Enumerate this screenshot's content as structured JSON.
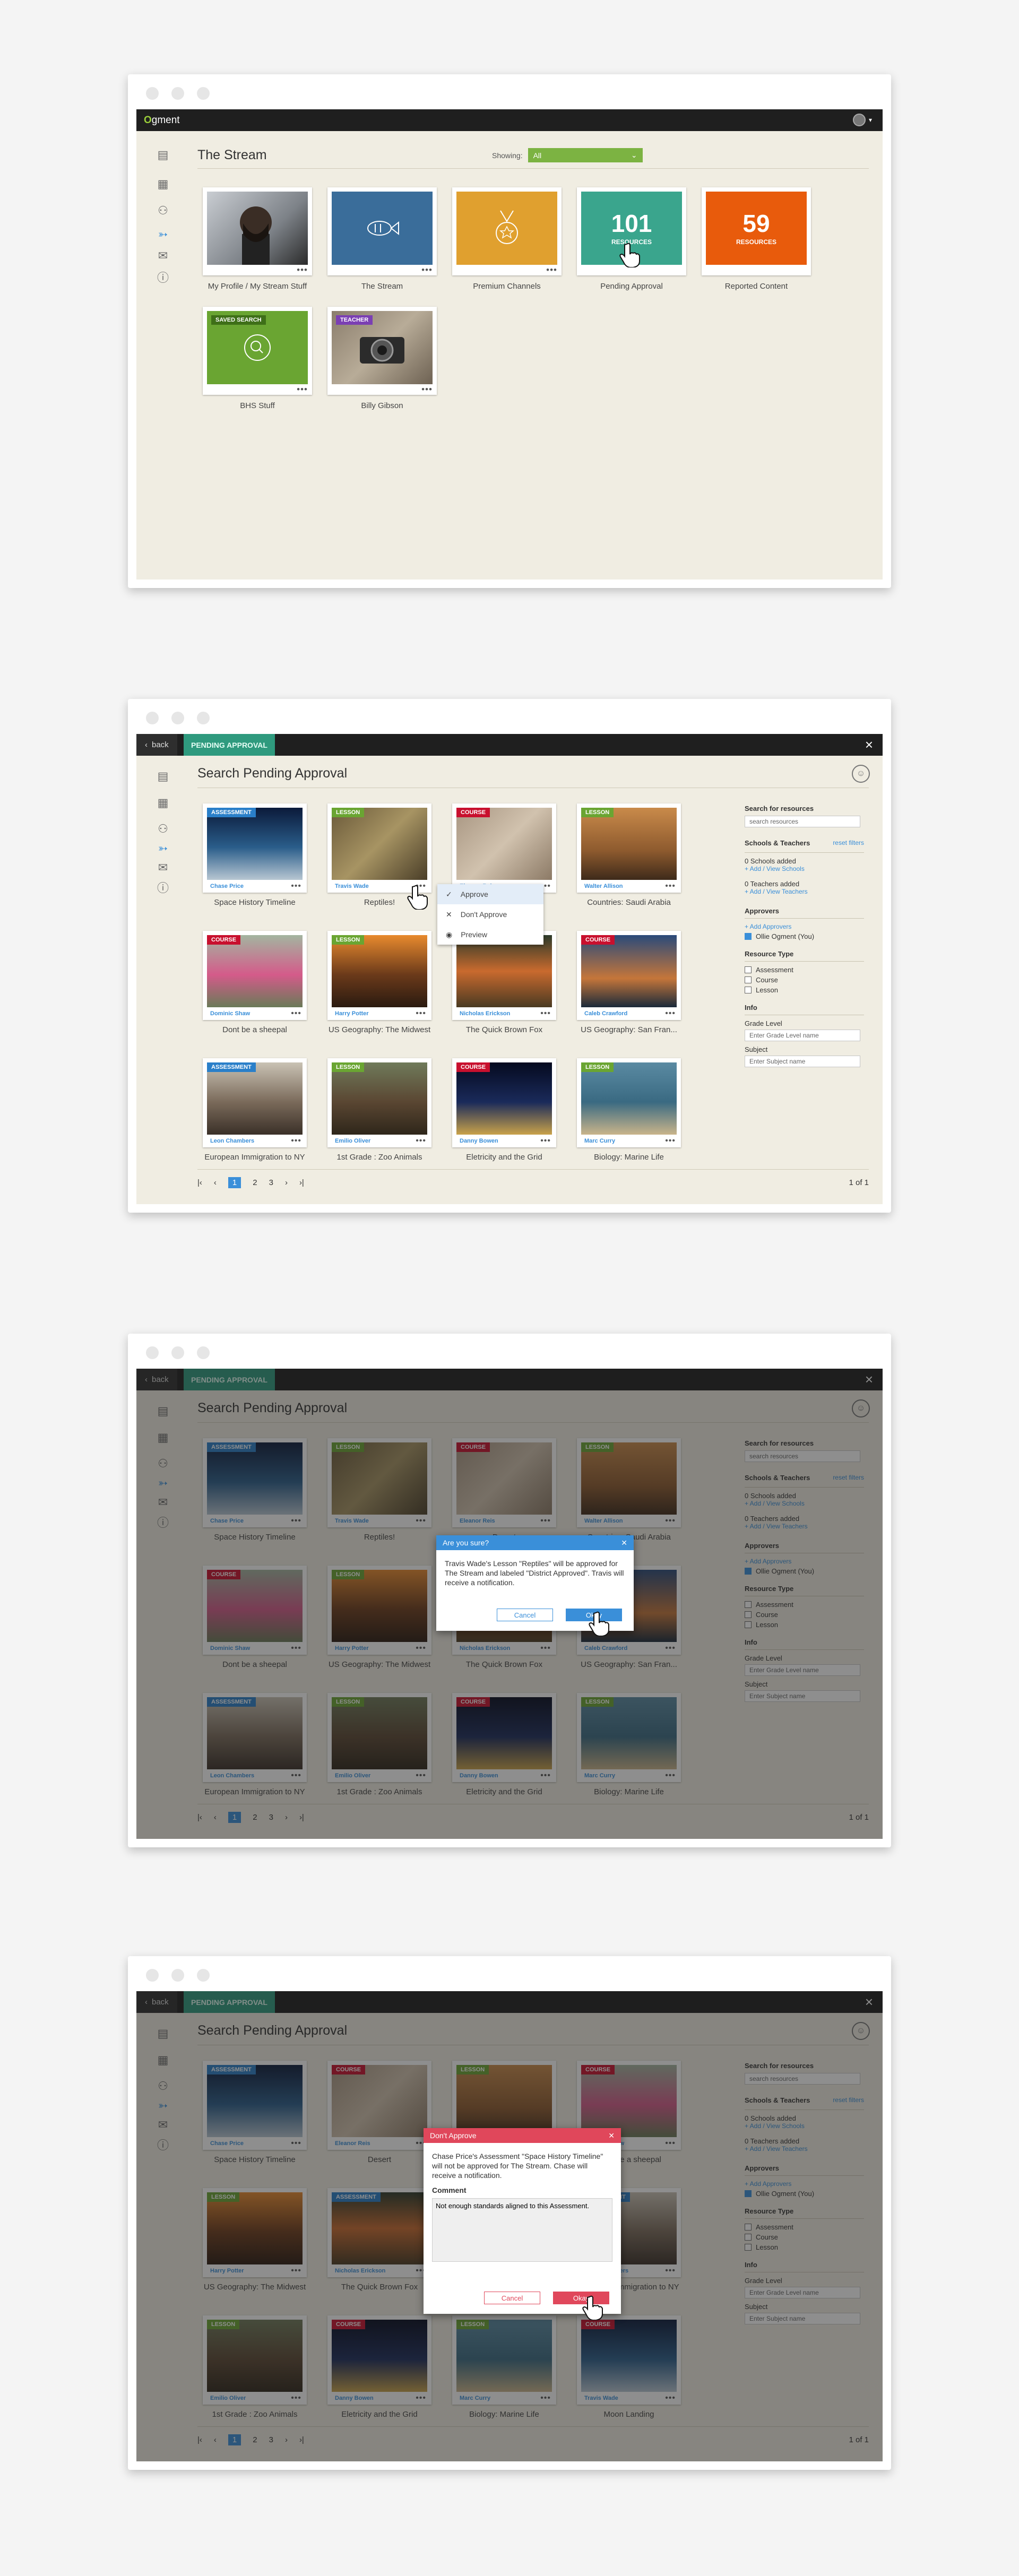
{
  "app": {
    "logo_prefix": "O",
    "logo_rest": "gment"
  },
  "panel1": {
    "title": "The Stream",
    "showing_label": "Showing:",
    "showing_value": "All",
    "tiles": [
      {
        "caption": "My Profile / My Stream Stuff"
      },
      {
        "caption": "The Stream"
      },
      {
        "caption": "Premium Channels"
      },
      {
        "caption": "Pending Approval",
        "count": "101",
        "unit": "RESOURCES"
      },
      {
        "caption": "Reported Content",
        "count": "59",
        "unit": "RESOURCES"
      },
      {
        "caption": "BHS Stuff",
        "badge": "SAVED SEARCH"
      },
      {
        "caption": "Billy Gibson",
        "badge": "TEACHER"
      }
    ]
  },
  "pending": {
    "back": "back",
    "mode": "PENDING APPROVAL",
    "title": "Search Pending Approval",
    "filters": {
      "search_heading": "Search for resources",
      "search_placeholder": "search resources",
      "schools_heading": "Schools & Teachers",
      "reset": "reset filters",
      "schools_added": "0 Schools added",
      "add_schools": "+ Add / View Schools",
      "teachers_added": "0 Teachers added",
      "add_teachers": "+ Add / View Teachers",
      "approvers_heading": "Approvers",
      "add_approvers": "+ Add Approvers",
      "approver_name": "Ollie Ogment (You)",
      "type_heading": "Resource Type",
      "types": [
        "Assessment",
        "Course",
        "Lesson"
      ],
      "info_heading": "Info",
      "grade_label": "Grade Level",
      "grade_placeholder": "Enter Grade Level name",
      "subject_label": "Subject",
      "subject_placeholder": "Enter Subject name"
    },
    "pager": {
      "pages": [
        "1",
        "2",
        "3"
      ],
      "status": "1 of 1"
    }
  },
  "resources_a": [
    {
      "type": "ASSESSMENT",
      "author": "Chase Price",
      "title": "Space History Timeline"
    },
    {
      "type": "LESSON",
      "author": "Travis Wade",
      "title": "Reptiles!"
    },
    {
      "type": "COURSE",
      "author": "Eleanor Reis",
      "title": "Desert"
    },
    {
      "type": "LESSON",
      "author": "Walter Allison",
      "title": "Countries: Saudi Arabia"
    },
    {
      "type": "COURSE",
      "author": "Dominic Shaw",
      "title": "Dont be a sheepal"
    },
    {
      "type": "LESSON",
      "author": "Harry Potter",
      "title": "US Geography: The Midwest"
    },
    {
      "type": "ASSESSMENT",
      "author": "Nicholas Erickson",
      "title": "The Quick Brown Fox"
    },
    {
      "type": "COURSE",
      "author": "Caleb Crawford",
      "title": "US Geography: San Fran..."
    },
    {
      "type": "ASSESSMENT",
      "author": "Leon Chambers",
      "title": "European Immigration to NY"
    },
    {
      "type": "LESSON",
      "author": "Emilio Oliver",
      "title": "1st Grade : Zoo Animals"
    },
    {
      "type": "COURSE",
      "author": "Danny Bowen",
      "title": "Eletricity and the Grid"
    },
    {
      "type": "LESSON",
      "author": "Marc Curry",
      "title": "Biology: Marine Life"
    }
  ],
  "resources_b": [
    {
      "type": "ASSESSMENT",
      "author": "Chase Price",
      "title": "Space History Timeline"
    },
    {
      "type": "COURSE",
      "author": "Eleanor Reis",
      "title": "Desert"
    },
    {
      "type": "LESSON",
      "author": "Walter Allison",
      "title": "Countries: Saudi Arabia"
    },
    {
      "type": "COURSE",
      "author": "Dominic Shaw",
      "title": "Dont be a sheepal"
    },
    {
      "type": "LESSON",
      "author": "Harry Potter",
      "title": "US Geography: The Midwest"
    },
    {
      "type": "ASSESSMENT",
      "author": "Nicholas Erickson",
      "title": "The Quick Brown Fox"
    },
    {
      "type": "COURSE",
      "author": "Caleb Crawford",
      "title": "US Geography: San Fran..."
    },
    {
      "type": "ASSESSMENT",
      "author": "Leon Chambers",
      "title": "European Immigration to NY"
    },
    {
      "type": "LESSON",
      "author": "Emilio Oliver",
      "title": "1st Grade : Zoo Animals"
    },
    {
      "type": "COURSE",
      "author": "Danny Bowen",
      "title": "Eletricity and the Grid"
    },
    {
      "type": "LESSON",
      "author": "Marc Curry",
      "title": "Biology: Marine Life"
    },
    {
      "type": "COURSE",
      "author": "Travis Wade",
      "title": "Moon Landing"
    }
  ],
  "context_menu": {
    "items": [
      "Approve",
      "Don't Approve",
      "Preview"
    ]
  },
  "dialog_confirm": {
    "title": "Are you sure?",
    "body": "Travis Wade's Lesson \"Reptiles\" will be approved for The Stream and labeled \"District Approved\". Travis will receive a notification.",
    "cancel": "Cancel",
    "ok": "Okay"
  },
  "dialog_reject": {
    "title": "Don't Approve",
    "body": "Chase Price's Assessment \"Space History Timeline\" will not be approved for The Stream. Chase will receive a notification.",
    "comment_label": "Comment",
    "comment": "Not enough standards aligned to this Assessment.",
    "cancel": "Cancel",
    "ok": "Okay"
  },
  "colors": {
    "assessment": "#2a7fc9",
    "lesson": "#6aa532",
    "course": "#c8102e",
    "teacher": "#7b3fb3",
    "saved": "#4f8a22",
    "accent": "#3a8fd9",
    "confirm_header": "#3a8fd9",
    "reject_header": "#e0475b"
  }
}
